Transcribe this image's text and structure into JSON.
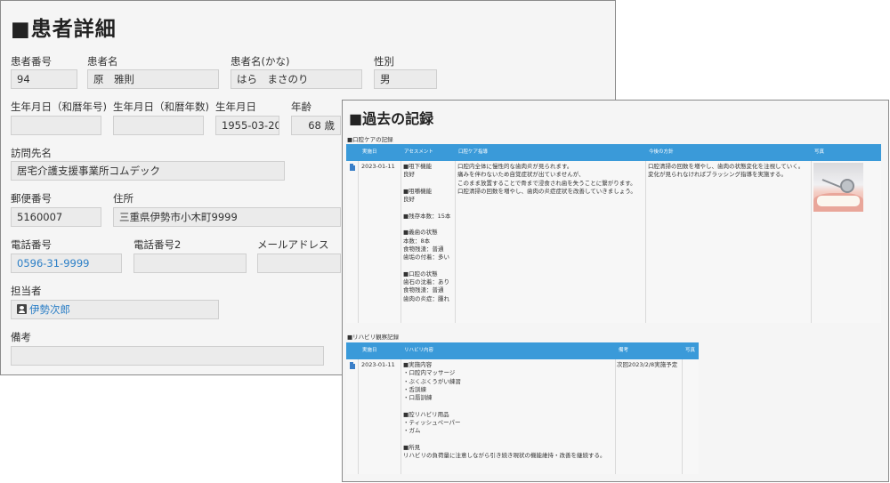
{
  "patient": {
    "title": "■患者詳細",
    "fields": {
      "patient_no": {
        "label": "患者番号",
        "value": "94"
      },
      "name": {
        "label": "患者名",
        "value": "原　雅則"
      },
      "name_kana": {
        "label": "患者名(かな)",
        "value": "はら　まさのり"
      },
      "gender": {
        "label": "性別",
        "value": "男"
      },
      "birth_wareki": {
        "label": "生年月日（和暦年号)",
        "value": ""
      },
      "birth_wareki_num": {
        "label": "生年月日（和暦年数)",
        "value": ""
      },
      "birth_date": {
        "label": "生年月日",
        "value": "1955-03-20"
      },
      "age": {
        "label": "年齢",
        "value": "68 歳"
      },
      "visit_place": {
        "label": "訪問先名",
        "value": "居宅介護支援事業所コムデック"
      },
      "postal_code": {
        "label": "郵便番号",
        "value": "5160007"
      },
      "address": {
        "label": "住所",
        "value": "三重県伊勢市小木町9999"
      },
      "phone": {
        "label": "電話番号",
        "value": "0596-31-9999"
      },
      "phone2": {
        "label": "電話番号2",
        "value": ""
      },
      "email": {
        "label": "メールアドレス",
        "value": ""
      },
      "staff": {
        "label": "担当者",
        "value": "伊勢次郎"
      },
      "remarks": {
        "label": "備考",
        "value": ""
      }
    }
  },
  "records": {
    "title": "■過去の記録",
    "oral_care": {
      "section_label": "■口腔ケアの記録",
      "headers": [
        "実施日",
        "アセスメント",
        "口腔ケア指導",
        "今後の方針",
        "写真"
      ],
      "rows": [
        {
          "date": "2023-01-11",
          "assessment": "■咀下機能\n良好\n\n■咀嚼機能\n良好\n\n■残存本数：15本\n\n■義歯の状態\n本数：8本\n食物残渣：普通\n歯垢の付着：多い\n\n■口腔の状態\n歯石の沈着：あり\n食物残渣：普通\n歯肉の炎症：腫れ",
          "guidance": "口腔内全体に慢性的な歯肉炎が見られます。\n痛みを伴わないため自覚症状が出ていませんが、\nこのまま放置することで骨まで浸食され歯を失うことに繋がります。\n口腔清掃の回数を増やし、歯肉の炎症症状を改善していきましょう。",
          "policy": "口腔清掃の回数を増やし、歯肉の状態変化を注視していく。\n変化が見られなければブラッシング指導を実施する。",
          "photo": "dental-photo"
        }
      ]
    },
    "rehab": {
      "section_label": "■リハビリ観察記録",
      "headers": [
        "実施日",
        "リハビリ内容",
        "備考",
        "写真"
      ],
      "rows": [
        {
          "date": "2023-01-11",
          "content": "■実施内容\n・口腔内マッサージ\n・ぶくぶくうがい練習\n・舌訓練\n・口唇訓練\n\n■腔リハビリ用品\n・ティッシュペーパー\n・ガム\n\n■所見\nリハビリの負荷量に注意しながら引き続き現状の機能維持・改善を継続する。",
          "note": "次回2023/2/8実施予定"
        }
      ]
    }
  },
  "colors": {
    "table_header": "#3a9ad9",
    "link": "#2a7ec6"
  }
}
